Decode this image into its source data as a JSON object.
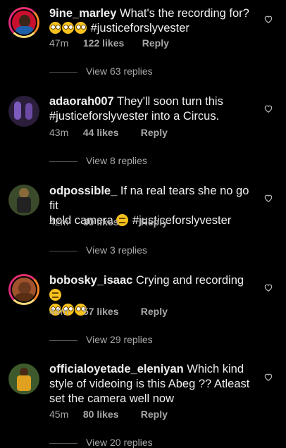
{
  "colors": {
    "background": "#000000",
    "text": "#f0f0f0",
    "meta": "#a8a8a8"
  },
  "comments": [
    {
      "username": "9ine_marley",
      "body": "What's the recording for?",
      "hashtag": "#justiceforslyvester",
      "time": "47m",
      "likes": "122 likes",
      "reply": "Reply",
      "view_replies": "View 63 replies",
      "emojis": [
        "rolling-eyes-emoji",
        "rolling-eyes-emoji",
        "rolling-eyes-emoji"
      ]
    },
    {
      "username": "adaorah007",
      "body": "They'll soon turn this",
      "body2": "#justiceforslyvester into a Circus.",
      "time": "43m",
      "likes": "44 likes",
      "reply": "Reply",
      "view_replies": "View 8 replies"
    },
    {
      "username": "odpossible_",
      "body": "If na real tears she no go fit",
      "body2": "hold camera",
      "hashtag": "#justiceforslyvester",
      "time": "42m",
      "likes": "30 likes",
      "reply": "Reply",
      "view_replies": "View 3 replies",
      "emojis": [
        "smirking-emoji"
      ]
    },
    {
      "username": "bobosky_isaac",
      "body": "Crying and recording",
      "time": "44m",
      "likes": "57 likes",
      "reply": "Reply",
      "view_replies": "View 29 replies",
      "emojis": [
        "smirking-emoji",
        "rolling-eyes-emoji",
        "rolling-eyes-emoji",
        "rolling-eyes-emoji"
      ]
    },
    {
      "username": "officialoyetade_eleniyan",
      "body": "Which kind",
      "body2": "style of videoing is this Abeg ?? Atleast",
      "body3": "set the camera well now",
      "time": "45m",
      "likes": "80 likes",
      "reply": "Reply",
      "view_replies": "View 20 replies"
    }
  ]
}
